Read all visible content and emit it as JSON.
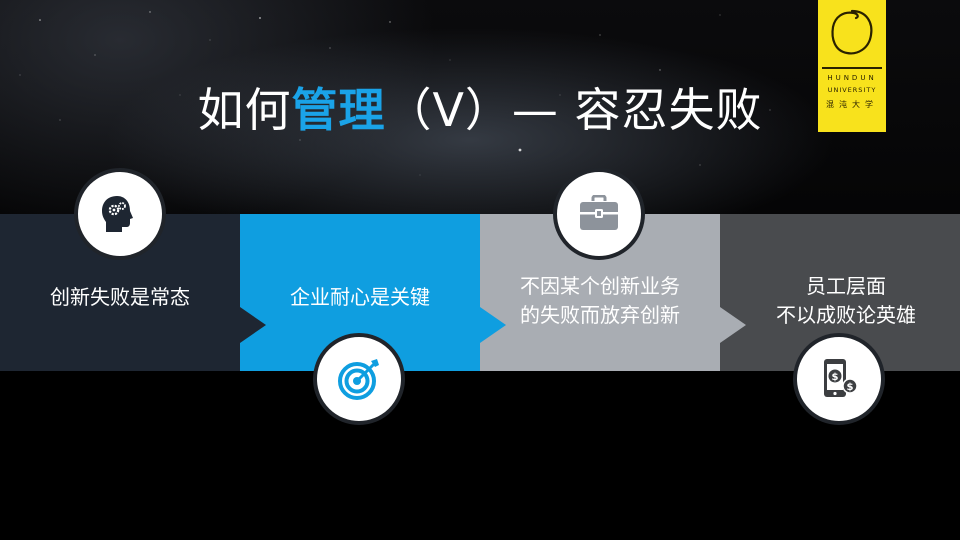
{
  "slide": {
    "title_pre": "如何",
    "title_accent": "管理",
    "title_post": "（V）— 容忍失败"
  },
  "logo": {
    "line1": "HUNDUN",
    "line2": "UNIVERSITY",
    "line3": "混沌大学"
  },
  "panels": [
    {
      "lines": [
        "创新失败是常态"
      ],
      "icon": "head-gears-icon",
      "color": "#1e2632"
    },
    {
      "lines": [
        "企业耐心是关键"
      ],
      "icon": "target-icon",
      "color": "#0f9ee0"
    },
    {
      "lines": [
        "不因某个创新业务",
        "的失败而放弃创新"
      ],
      "icon": "briefcase-icon",
      "color": "#a9adb3"
    },
    {
      "lines": [
        "员工层面",
        "不以成败论英雄"
      ],
      "icon": "phone-money-icon",
      "color": "#494b4e"
    }
  ],
  "colors": {
    "accent": "#1aa3e8",
    "logo_yellow": "#f8e21c"
  }
}
